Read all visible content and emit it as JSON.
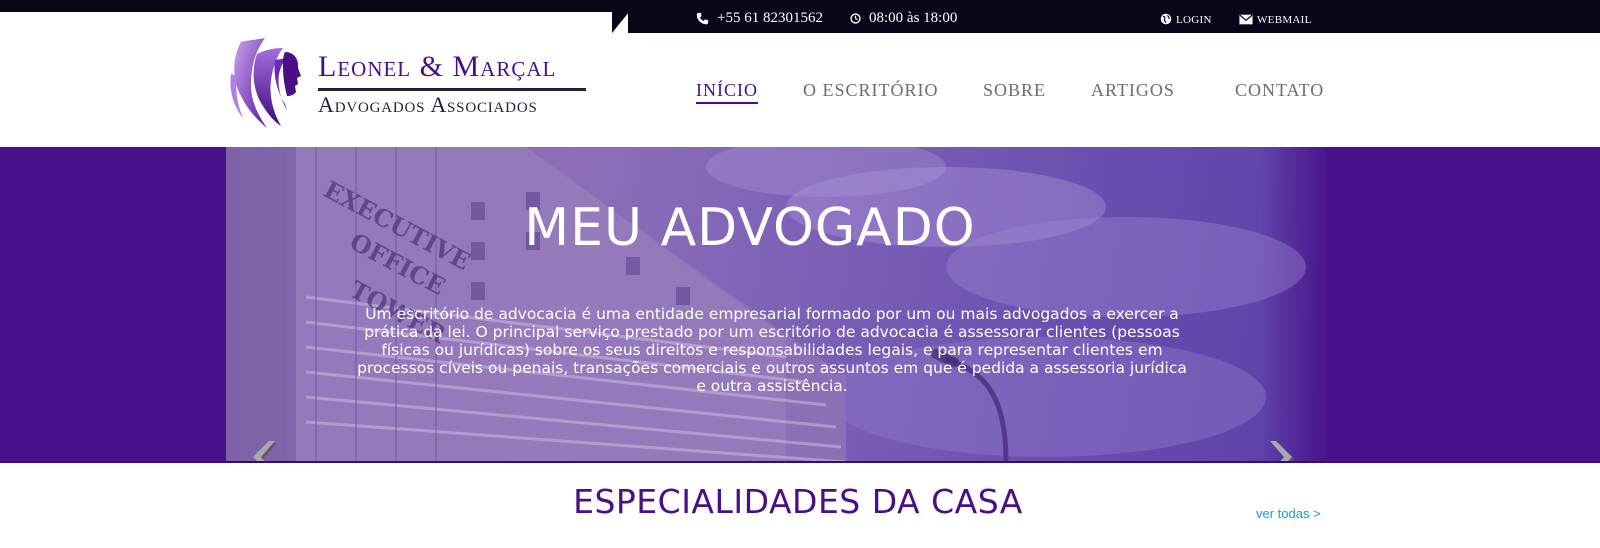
{
  "topbar": {
    "phone": "+55 61 82301562",
    "hours": "08:00 às 18:00",
    "login": "login",
    "webmail": "webmail"
  },
  "brand": {
    "name": "Leonel & Marçal",
    "subtitle": "Advogados Associados"
  },
  "nav": {
    "items": [
      {
        "label": "INÍCIO",
        "active": true
      },
      {
        "label": "O ESCRITÓRIO",
        "active": false
      },
      {
        "label": "SOBRE",
        "active": false
      },
      {
        "label": "ARTIGOS",
        "active": false
      },
      {
        "label": "CONTATO",
        "active": false
      }
    ]
  },
  "hero": {
    "title": "MEU ADVOGADO",
    "text": "Um escritório de advocacia é uma entidade empresarial formado por um ou mais advogados a exercer a prática da lei. O principal serviço prestado por um escritório de advocacia é assessorar clientes (pessoas físicas ou jurídicas) sobre os seus direitos e responsabilidades legais, e para representar clientes em processos cíveis ou penais, transações comerciais e outros assuntos em que é pedida a assessoria jurídica e outra assistência.",
    "building_sign": "EXECUTIVE OFFICE TOWER"
  },
  "specialties": {
    "title": "ESPECIALIDADES DA CASA",
    "see_all": "ver todas >"
  },
  "colors": {
    "brand_purple": "#4a0e86",
    "topbar_dark": "#0b0517",
    "link_blue": "#1d9ad6"
  }
}
